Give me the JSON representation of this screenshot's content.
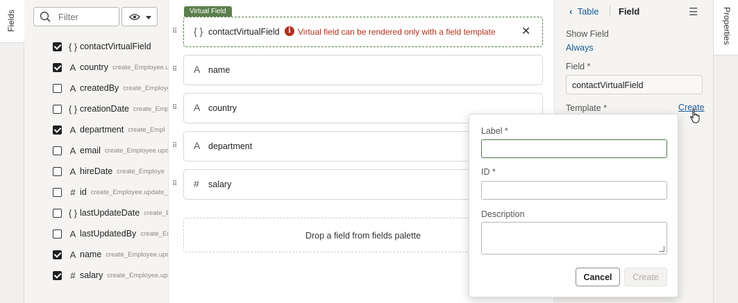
{
  "left_tab": {
    "label": "Fields"
  },
  "right_tab": {
    "label": "Properties"
  },
  "palette": {
    "search_placeholder": "Filter",
    "view_icon": "eye-icon",
    "fields": [
      {
        "name": "contactVirtualField",
        "type": "{ }",
        "source": "",
        "checked": true
      },
      {
        "name": "country",
        "type": "A",
        "source": "create_Employee.u",
        "checked": true
      },
      {
        "name": "createdBy",
        "type": "A",
        "source": "create_Employe",
        "checked": false
      },
      {
        "name": "creationDate",
        "type": "{ }",
        "source": "create_Emp",
        "checked": false
      },
      {
        "name": "department",
        "type": "A",
        "source": "create_Empl",
        "checked": true
      },
      {
        "name": "email",
        "type": "A",
        "source": "create_Employee.upd",
        "checked": false
      },
      {
        "name": "hireDate",
        "type": "A",
        "source": "create_Employe",
        "checked": false
      },
      {
        "name": "id",
        "type": "#",
        "source": "create_Employee.update_",
        "checked": false
      },
      {
        "name": "lastUpdateDate",
        "type": "{ }",
        "source": "create_E",
        "checked": false
      },
      {
        "name": "lastUpdatedBy",
        "type": "A",
        "source": "create_En",
        "checked": false
      },
      {
        "name": "name",
        "type": "A",
        "source": "create_Employee.upd",
        "checked": true
      },
      {
        "name": "salary",
        "type": "#",
        "source": "create_Employee.up",
        "checked": true
      }
    ]
  },
  "canvas": {
    "badge": "Virtual Field",
    "virtual_field": {
      "type": "{ }",
      "name": "contactVirtualField",
      "error_icon": "i",
      "error": "Virtual field can be rendered only with a field template",
      "close": "✕"
    },
    "cards": [
      {
        "type": "A",
        "name": "name"
      },
      {
        "type": "A",
        "name": "country"
      },
      {
        "type": "A",
        "name": "department"
      },
      {
        "type": "#",
        "name": "salary"
      }
    ],
    "handle": "⠿",
    "drop_text": "Drop a field from fields palette"
  },
  "properties": {
    "back": "Table",
    "current": "Field",
    "menu": "☰",
    "show_field_label": "Show Field",
    "show_field_value": "Always",
    "field_label": "Field *",
    "field_value": "contactVirtualField",
    "template_label": "Template *",
    "template_create": "Create"
  },
  "popup": {
    "label_label": "Label *",
    "label_value": "",
    "id_label": "ID *",
    "id_value": "",
    "desc_label": "Description",
    "cancel": "Cancel",
    "create": "Create"
  }
}
